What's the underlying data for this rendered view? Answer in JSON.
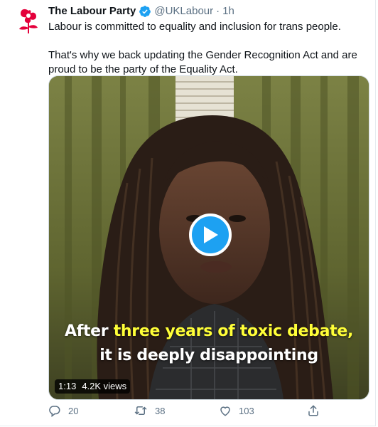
{
  "tweet": {
    "display_name": "The Labour Party",
    "handle": "@UKLabour",
    "separator": "·",
    "time": "1h",
    "paragraphs": [
      "Labour is committed to equality and inclusion for trans people.",
      "That's why we back updating the Gender Recognition Act and are proud to be the party of the Equality Act."
    ]
  },
  "video": {
    "caption_line1_prefix": "After ",
    "caption_line1_highlight": "three years of toxic debate,",
    "caption_line2": "it is deeply disappointing",
    "duration": "1:13",
    "views": "4.2K views"
  },
  "actions": {
    "reply_count": "20",
    "retweet_count": "38",
    "like_count": "103"
  },
  "colors": {
    "accent": "#1da1f2",
    "muted_text": "#5b7083",
    "labour_red": "#e4003b",
    "caption_highlight": "#ffff38"
  },
  "icons": [
    "labour-rose-icon",
    "verified-badge-icon",
    "play-icon",
    "reply-icon",
    "retweet-icon",
    "like-icon",
    "share-icon"
  ]
}
